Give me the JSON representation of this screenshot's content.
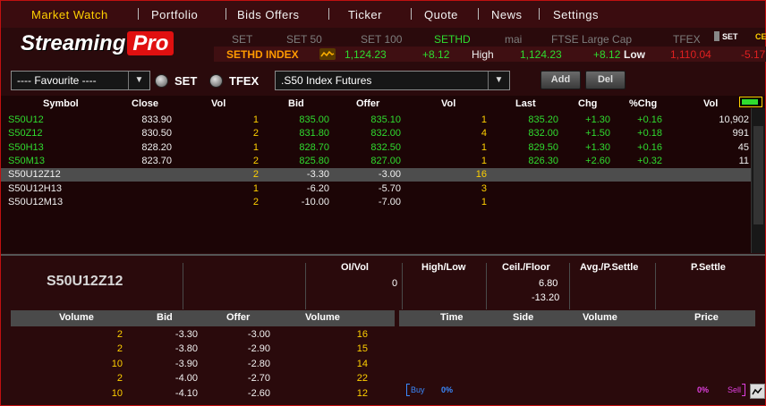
{
  "menu": {
    "items": [
      "Market Watch",
      "Portfolio",
      "Bids Offers",
      "Ticker",
      "Quote",
      "News",
      "Settings"
    ]
  },
  "logo": {
    "text_a": "Streaming",
    "text_b": "Pro"
  },
  "index_tabs": [
    "SET",
    "SET 50",
    "SET 100",
    "SETHD",
    "mai",
    "FTSE Large Cap",
    "TFEX"
  ],
  "index_tabs_active": "SETHD",
  "side_tab": "SET",
  "side_tab2": "CE",
  "index_row": {
    "name": "SETHD INDEX",
    "icon": "sparkline-icon",
    "value": "1,124.23",
    "change": "+8.12",
    "high_label": "High",
    "high": "1,124.23",
    "high_change": "+8.12",
    "low_label": "Low",
    "low": "1,110.04",
    "low_change": "-5.17"
  },
  "toolbar": {
    "favourite": "---- Favourite ----",
    "radio_set": "SET",
    "radio_tfex": "TFEX",
    "series": ".S50 Index Futures",
    "add": "Add",
    "del": "Del"
  },
  "grid": {
    "headers": [
      "Symbol",
      "Close",
      "Vol",
      "Bid",
      "Offer",
      "Vol",
      "Last",
      "Chg",
      "%Chg",
      "Vol"
    ],
    "rows": [
      {
        "symbol": "S50U12",
        "close": "833.90",
        "bvol": "1",
        "bid": "835.00",
        "offer": "835.10",
        "ovol": "1",
        "last": "835.20",
        "chg": "+1.30",
        "pchg": "+0.16",
        "vol": "10,902",
        "kind": "fut"
      },
      {
        "symbol": "S50Z12",
        "close": "830.50",
        "bvol": "2",
        "bid": "831.80",
        "offer": "832.00",
        "ovol": "4",
        "last": "832.00",
        "chg": "+1.50",
        "pchg": "+0.18",
        "vol": "991",
        "kind": "fut"
      },
      {
        "symbol": "S50H13",
        "close": "828.20",
        "bvol": "1",
        "bid": "828.70",
        "offer": "832.50",
        "ovol": "1",
        "last": "829.50",
        "chg": "+1.30",
        "pchg": "+0.16",
        "vol": "45",
        "kind": "fut"
      },
      {
        "symbol": "S50M13",
        "close": "823.70",
        "bvol": "2",
        "bid": "825.80",
        "offer": "827.00",
        "ovol": "1",
        "last": "826.30",
        "chg": "+2.60",
        "pchg": "+0.32",
        "vol": "11",
        "kind": "fut"
      },
      {
        "symbol": "S50U12Z12",
        "close": "",
        "bvol": "2",
        "bid": "-3.30",
        "offer": "-3.00",
        "ovol": "16",
        "last": "",
        "chg": "",
        "pchg": "",
        "vol": "",
        "kind": "spread_sel"
      },
      {
        "symbol": "S50U12H13",
        "close": "",
        "bvol": "1",
        "bid": "-6.20",
        "offer": "-5.70",
        "ovol": "3",
        "last": "",
        "chg": "",
        "pchg": "",
        "vol": "",
        "kind": "spread"
      },
      {
        "symbol": "S50U12M13",
        "close": "",
        "bvol": "2",
        "bid": "-10.00",
        "offer": "-7.00",
        "ovol": "1",
        "last": "",
        "chg": "",
        "pchg": "",
        "vol": "",
        "kind": "spread"
      }
    ]
  },
  "detail": {
    "symbol": "S50U12Z12",
    "oivol_label": "OI/Vol",
    "oivol": "0",
    "highlow_label": "High/Low",
    "ceilfloor_label": "Ceil./Floor",
    "ceil": "6.80",
    "floor": "-13.20",
    "avg_label": "Avg./P.Settle",
    "psettle_label": "P.Settle"
  },
  "depth": {
    "headers": [
      "Volume",
      "Bid",
      "Offer",
      "Volume"
    ],
    "rows": [
      {
        "bvol": "2",
        "bid": "-3.30",
        "offer": "-3.00",
        "ovol": "16"
      },
      {
        "bvol": "2",
        "bid": "-3.80",
        "offer": "-2.90",
        "ovol": "15"
      },
      {
        "bvol": "10",
        "bid": "-3.90",
        "offer": "-2.80",
        "ovol": "14"
      },
      {
        "bvol": "2",
        "bid": "-4.00",
        "offer": "-2.70",
        "ovol": "22"
      },
      {
        "bvol": "10",
        "bid": "-4.10",
        "offer": "-2.60",
        "ovol": "12"
      }
    ]
  },
  "trades": {
    "headers": [
      "Time",
      "Side",
      "Volume",
      "Price"
    ],
    "buy_label": "Buy",
    "buy_pct": "0%",
    "sell_pct": "0%",
    "sell_label": "Sell"
  },
  "colors": {
    "future": "#2fdc2f",
    "spread": "#f0f0f0",
    "volume": "#ffd000",
    "selected_row": "#4d4d4d",
    "background": "#2a0a0c"
  }
}
